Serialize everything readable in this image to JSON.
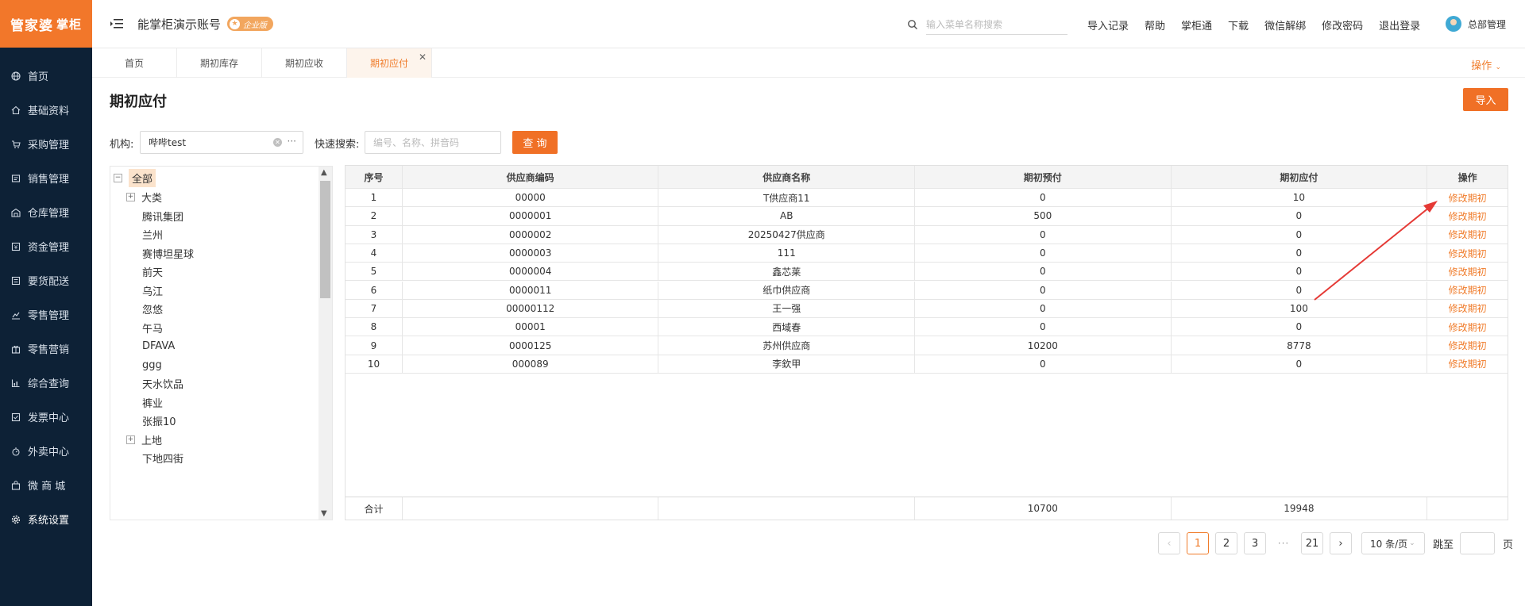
{
  "brand": {
    "logo": "管家婆",
    "logo_sub": "掌柜"
  },
  "sidebar": {
    "items": [
      {
        "label": "首页",
        "icon": "globe-icon"
      },
      {
        "label": "基础资料",
        "icon": "home-icon"
      },
      {
        "label": "采购管理",
        "icon": "cart-icon"
      },
      {
        "label": "销售管理",
        "icon": "sales-icon"
      },
      {
        "label": "仓库管理",
        "icon": "warehouse-icon"
      },
      {
        "label": "资金管理",
        "icon": "money-icon"
      },
      {
        "label": "要货配送",
        "icon": "delivery-icon"
      },
      {
        "label": "零售管理",
        "icon": "chart-icon"
      },
      {
        "label": "零售营销",
        "icon": "gift-icon"
      },
      {
        "label": "综合查询",
        "icon": "bar-chart-icon"
      },
      {
        "label": "发票中心",
        "icon": "invoice-icon"
      },
      {
        "label": "外卖中心",
        "icon": "takeout-icon"
      },
      {
        "label": "微 商 城",
        "icon": "bag-icon"
      },
      {
        "label": "系统设置",
        "icon": "gear-icon"
      }
    ]
  },
  "header": {
    "account": "能掌柜演示账号",
    "edition": "企业版",
    "search_placeholder": "输入菜单名称搜索",
    "links": [
      "导入记录",
      "帮助",
      "掌柜通",
      "下载",
      "微信解绑",
      "修改密码",
      "退出登录"
    ],
    "user": "总部管理"
  },
  "tabs": {
    "items": [
      "首页",
      "期初库存",
      "期初应收",
      "期初应付"
    ],
    "ops_label": "操作"
  },
  "page": {
    "title": "期初应付",
    "import_label": "导入",
    "org_label": "机构",
    "org_value": "哔哔test",
    "quick_label": "快速搜索",
    "quick_placeholder": "编号、名称、拼音码",
    "query_label": "查 询"
  },
  "tree": {
    "root": "全部",
    "nodes": [
      "大类",
      "腾讯集团",
      "兰州",
      "赛博坦星球",
      "前天",
      "乌江",
      "忽悠",
      "午马",
      "DFAVA",
      "ggg",
      "天水饮品",
      "裤业",
      "张振10",
      "上地",
      "下地四街"
    ]
  },
  "table": {
    "headers": [
      "序号",
      "供应商编码",
      "供应商名称",
      "期初预付",
      "期初应付",
      "操作"
    ],
    "op_label": "修改期初",
    "rows": [
      [
        "1",
        "00000",
        "T供应商11",
        "0",
        "10"
      ],
      [
        "2",
        "0000001",
        "AB",
        "500",
        "0"
      ],
      [
        "3",
        "0000002",
        "20250427供应商",
        "0",
        "0"
      ],
      [
        "4",
        "0000003",
        "111",
        "0",
        "0"
      ],
      [
        "5",
        "0000004",
        "鑫芯莱",
        "0",
        "0"
      ],
      [
        "6",
        "0000011",
        "纸巾供应商",
        "0",
        "0"
      ],
      [
        "7",
        "00000112",
        "王一强",
        "0",
        "100"
      ],
      [
        "8",
        "00001",
        "西域春",
        "0",
        "0"
      ],
      [
        "9",
        "0000125",
        "苏州供应商",
        "10200",
        "8778"
      ],
      [
        "10",
        "000089",
        "李欽甲",
        "0",
        "0"
      ]
    ],
    "summary": {
      "label": "合计",
      "prepaid": "10700",
      "payable": "19948"
    }
  },
  "pager": {
    "pages": [
      "1",
      "2",
      "3"
    ],
    "last": "21",
    "dots": "···",
    "page_size": "10 条/页",
    "jump_label": "跳至",
    "page_suffix": "页"
  },
  "colors": {
    "accent": "#f07026",
    "sidebar_bg": "#0d2136"
  }
}
